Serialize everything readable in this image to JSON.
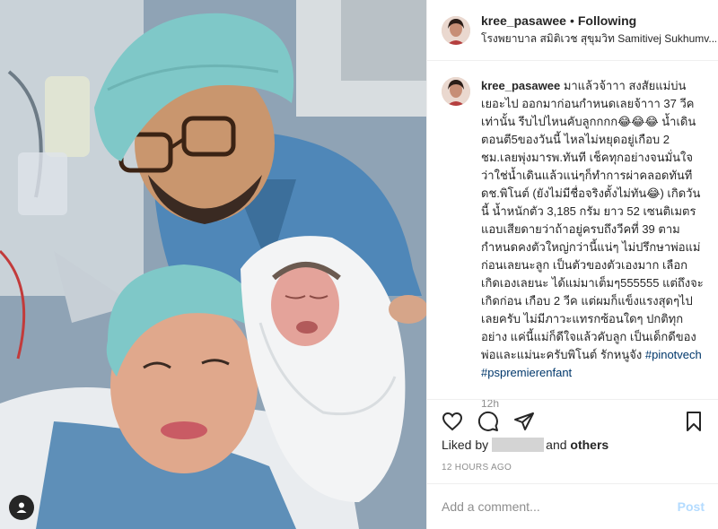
{
  "post": {
    "username": "kree_pasawee",
    "separator": "•",
    "following_label": "Following",
    "location": "โรงพยาบาล สมิติเวช สุขุมวิท Samitivej Sukhumv..."
  },
  "caption": {
    "username": "kree_pasawee",
    "text": "มาแล้วจ้าาา สงสัยแม่บ่นเยอะไป ออกมาก่อนกำหนดเลยจ้าาา 37 วีคเท่านั้น รีบไปไหนคับลูกกกก😂😂😂 น้ำเดินตอนตี5ของวันนี้ ไหลไม่หยุดอยู่เกือบ 2 ชม.เลยพุ่งมารพ.ทันที เช็คทุกอย่างจนมั่นใจว่าใช่น้ำเดินแล้วแน่ๆก็ทำการผ่าคลอดทันที ดช.พิโนต์ (ยังไม่มีชื่อจริงตั้งไม่ทัน😂) เกิดวันนี้ น้ำหนักตัว 3,185 กรัม ยาว 52 เซนติเมตร แอบเสียดายว่าถ้าอยู่ครบถึงวีคที่ 39 ตามกำหนดคงตัวใหญ่กว่านี้แน่ๆ ไม่ปรึกษาพ่อแม่ก่อนเลยนะลูก เป็นตัวของตัวเองมาก เลือกเกิดเองเลยนะ ได้แม่มาเต็มๆ555555 แต่ถึงจะเกิดก่อน เกือบ 2 วีค แต่ผมก็แข็งแรงสุดๆไปเลยครับ ไม่มีภาวะแทรกซ้อนใดๆ ปกติทุกอย่าง แค่นี้แม่ก็ดีใจแล้วคับลูก เป็นเด็กดีของพ่อและแม่นะครับพิโนต์ รักหนูจัง",
    "hashtag1": "#pinotvech",
    "hashtag2": "#pspremierenfant",
    "age": "12h"
  },
  "likes": {
    "prefix": "Liked by",
    "suffix": "and",
    "others": "others"
  },
  "timestamp": "12 HOURS AGO",
  "comment_box": {
    "placeholder": "Add a comment...",
    "post_label": "Post"
  },
  "icons": {
    "like": "heart-icon",
    "comment": "comment-icon",
    "share": "share-icon",
    "save": "bookmark-icon",
    "tagged": "user-tag-icon"
  },
  "colors": {
    "text": "#262626",
    "muted": "#8e8e8e",
    "hashtag": "#00376b",
    "post_disabled": "#b3dbff",
    "border": "#efefef"
  }
}
